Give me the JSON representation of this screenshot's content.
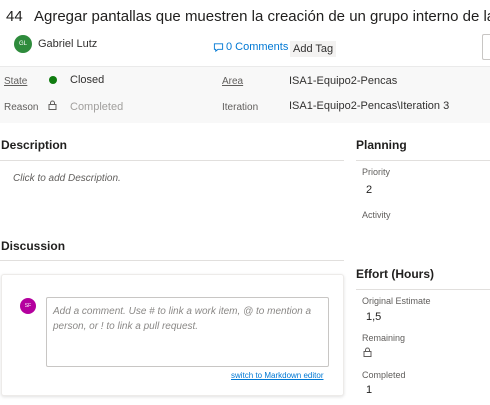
{
  "work_item": {
    "id": "44",
    "title": "Agregar pantallas que muestren la creación de un grupo interno de la aplicación",
    "assignee": {
      "initials": "GL",
      "name": "Gabriel Lutz"
    },
    "comments_link": "0 Comments",
    "add_tag_label": "Add Tag"
  },
  "fields": {
    "state_label": "State",
    "state_value": "Closed",
    "reason_label": "Reason",
    "reason_value": "Completed",
    "area_label": "Area",
    "area_value": "ISA1-Equipo2-Pencas",
    "iteration_label": "Iteration",
    "iteration_value": "ISA1-Equipo2-Pencas\\Iteration 3"
  },
  "description": {
    "heading": "Description",
    "placeholder": "Click to add Description."
  },
  "discussion": {
    "heading": "Discussion",
    "commenter_initials": "SF",
    "comment_placeholder": "Add a comment. Use # to link a work item, @ to mention a person, or ! to link a pull request.",
    "markdown_link": "switch to Markdown editor"
  },
  "planning": {
    "heading": "Planning",
    "priority_label": "Priority",
    "priority_value": "2",
    "activity_label": "Activity"
  },
  "effort": {
    "heading": "Effort (Hours)",
    "original_estimate_label": "Original Estimate",
    "original_estimate_value": "1,5",
    "remaining_label": "Remaining",
    "completed_label": "Completed",
    "completed_value": "1"
  },
  "colors": {
    "accent": "#0078d4",
    "state_closed": "#107c10",
    "assignee_avatar": "#2e8b3c",
    "commenter_avatar": "#b4009e"
  }
}
